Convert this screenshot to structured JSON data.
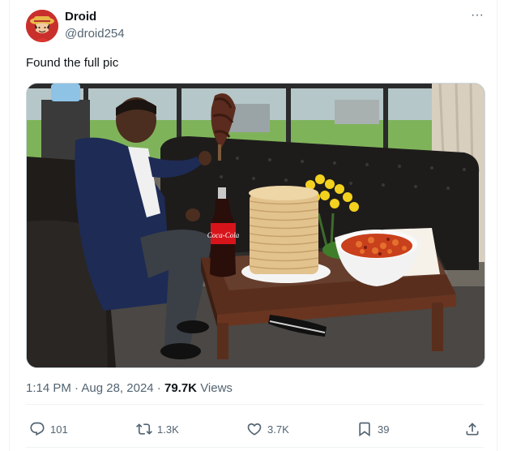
{
  "author": {
    "name": "Droid",
    "handle": "@droid254"
  },
  "tweet": {
    "text": "Found the full pic",
    "time": "1:14 PM",
    "separator": " · ",
    "date": "Aug 28, 2024",
    "views_count": "79.7K",
    "views_label": "Views"
  },
  "more_menu": {
    "icon": "more-horizontal-icon",
    "label": "···"
  },
  "actions": {
    "reply": {
      "icon": "reply-icon",
      "count": "101"
    },
    "retweet": {
      "icon": "retweet-icon",
      "count": "1.3K"
    },
    "like": {
      "icon": "heart-icon",
      "count": "3.7K"
    },
    "bookmark": {
      "icon": "bookmark-icon",
      "count": "39"
    },
    "share": {
      "icon": "share-icon"
    }
  },
  "media": {
    "bottle_label": "Coca-Cola"
  },
  "colors": {
    "text": "#0f1419",
    "secondary": "#536471",
    "border": "#eff3f4",
    "avatar": "#c9302c"
  }
}
